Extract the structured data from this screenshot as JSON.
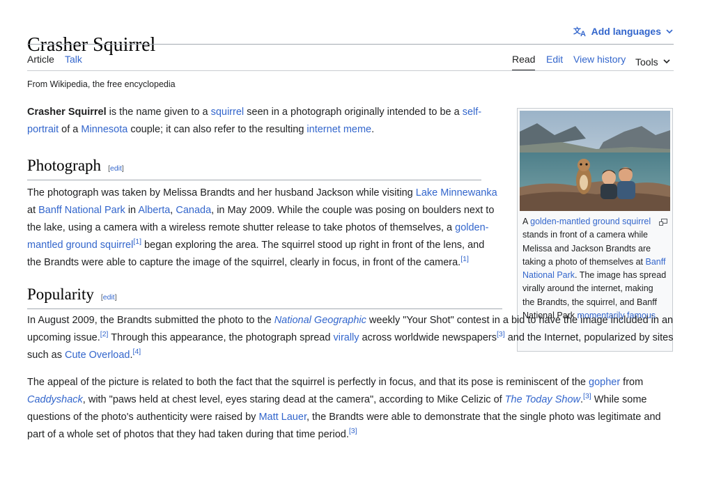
{
  "title": "Crasher Squirrel",
  "add_languages": "Add languages",
  "tabs": {
    "article": "Article",
    "talk": "Talk",
    "read": "Read",
    "edit": "Edit",
    "history": "View history",
    "tools": "Tools"
  },
  "tagline": "From Wikipedia, the free encyclopedia",
  "lead": {
    "bold": "Crasher Squirrel",
    "t1": " is the name given to a ",
    "l1": "squirrel",
    "t2": " seen in a photograph originally intended to be a ",
    "l2": "self-portrait",
    "t3": " of a ",
    "l3": "Minnesota",
    "t4": " couple; it can also refer to the resulting ",
    "l4": "internet meme",
    "t5": "."
  },
  "edit_label": "edit",
  "sec1": {
    "heading": "Photograph",
    "t1": "The photograph was taken by Melissa Brandts and her husband Jackson while visiting ",
    "l1": "Lake Minnewanka",
    "t2": " at ",
    "l2": "Banff National Park",
    "t3": " in ",
    "l3": "Alberta",
    "t4": ", ",
    "l4": "Canada",
    "t5": ", in May 2009. While the couple was posing on boulders next to the lake, using a camera with a wireless remote shutter release to take photos of themselves, a ",
    "l5": "golden-mantled ground squirrel",
    "r1": "[1]",
    "t6": " began exploring the area. The squirrel stood up right in front of the lens, and the Brandts were able to capture the image of the squirrel, clearly in focus, in front of the camera.",
    "r2": "[1]"
  },
  "sec2": {
    "heading": "Popularity",
    "p1": {
      "t1": "In August 2009, the Brandts submitted the photo to the ",
      "l1": "National Geographic",
      "t2": " weekly \"Your Shot\" contest in a bid to have the image included in an upcoming issue.",
      "r1": "[2]",
      "t3": " Through this appearance, the photograph spread ",
      "l2": "virally",
      "t4": " across worldwide newspapers",
      "r2": "[3]",
      "t5": " and the Internet, popularized by sites such as ",
      "l3": "Cute Overload",
      "t6": ".",
      "r3": "[4]"
    },
    "p2": {
      "t1": "The appeal of the picture is related to both the fact that the squirrel is perfectly in focus, and that its pose is reminiscent of the ",
      "l1": "gopher",
      "t2": " from ",
      "l2": "Caddyshack",
      "t3": ", with \"paws held at chest level, eyes staring dead at the camera\", according to Mike Celizic of ",
      "l3": "The Today Show",
      "t4": ".",
      "r1": "[3]",
      "t5": " While some questions of the photo's authenticity were raised by ",
      "l4": "Matt Lauer",
      "t6": ", the Brandts were able to demonstrate that the single photo was legitimate and part of a whole set of photos that they had taken during that time period.",
      "r2": "[3]"
    }
  },
  "caption": {
    "t1": "A ",
    "l1": "golden-mantled ground squirrel",
    "t2": " stands in front of a camera while Melissa and Jackson Brandts are taking a photo of themselves at ",
    "l2": "Banff National Park",
    "t3": ". The image has spread virally around the internet, making the Brandts, the squirrel, and Banff National Park ",
    "l3": "momentarily famous",
    "t4": "."
  },
  "colors": {
    "link": "#3366cc",
    "text": "#202122",
    "rule": "#a2a9b1"
  },
  "icons": {
    "language": "translate-icon",
    "chevron": "chevron-down-icon",
    "magnify": "enlarge-icon"
  }
}
